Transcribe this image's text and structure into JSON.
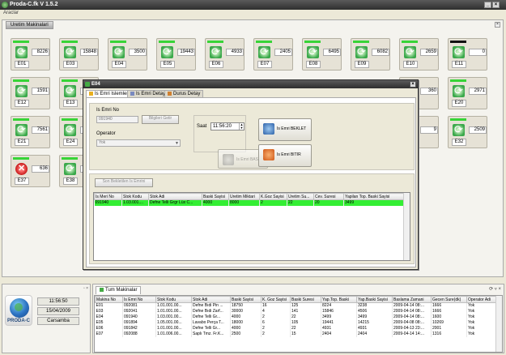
{
  "window": {
    "title": "Proda-C.fk V 1.5.2"
  },
  "menu": {
    "label": "Araclar"
  },
  "upper_tab": {
    "label": "Uretim Makinalari"
  },
  "machines": [
    {
      "label": "E01",
      "value": "8226",
      "status": "running"
    },
    {
      "label": "E03",
      "value": "15848",
      "status": "running"
    },
    {
      "label": "E04",
      "value": "3500",
      "status": "running"
    },
    {
      "label": "E05",
      "value": "19443",
      "status": "running"
    },
    {
      "label": "E06",
      "value": "4933",
      "status": "running"
    },
    {
      "label": "E07",
      "value": "2405",
      "status": "running"
    },
    {
      "label": "E08",
      "value": "6495",
      "status": "running"
    },
    {
      "label": "E09",
      "value": "6082",
      "status": "running"
    },
    {
      "label": "E10",
      "value": "2659",
      "status": "running"
    },
    {
      "label": "E11",
      "value": "0",
      "status": "idle"
    },
    {
      "label": "E12",
      "value": "1591",
      "status": "running"
    },
    {
      "label": "E13",
      "value": "",
      "status": "running"
    },
    {
      "label": "",
      "value": "360",
      "status": "running"
    },
    {
      "label": "E20",
      "value": "2971",
      "status": "running"
    },
    {
      "label": "E21",
      "value": "7561",
      "status": "running"
    },
    {
      "label": "E24",
      "value": "",
      "status": "running"
    },
    {
      "label": "",
      "value": "9",
      "status": "running"
    },
    {
      "label": "E32",
      "value": "2509",
      "status": "running"
    },
    {
      "label": "E37",
      "value": "636",
      "status": "stopped"
    },
    {
      "label": "E38",
      "value": "",
      "status": "running"
    }
  ],
  "dialog": {
    "title": "E04",
    "tabs": [
      "Is Emri Islemleri",
      "Is Emri Detay",
      "Durus Detay"
    ],
    "is_emri_label": "Is Emri No",
    "is_emri_value": "091940",
    "bilgileri_getir": "Bilgileri Getir",
    "operator_label": "Operator",
    "operator_value": "Yok",
    "saat_label": "Saat",
    "saat_value": "11:56:20",
    "is_emri_baslat": "Is Emri BASLAT",
    "is_emri_beklet": "Is Emri BEKLET",
    "is_emri_bitir": "Is Emri BITIR",
    "son_bekletilen": "Son Bekletilen Is Emrini",
    "grid_headers": [
      "Is Meri No",
      "Stok Kodu",
      "Stok Adi",
      "Baski Sayisi",
      "Uretim Miktari",
      "K.Goz Sayisi",
      "Uretim Su...",
      "Cev. Suresi",
      "Yapilan Top. Baski Sayisi"
    ],
    "grid_rows": [
      [
        "091940",
        "1.03.001....",
        "Defne Telli Grgr Lüx C...",
        "4000",
        "8000",
        "2",
        "22",
        "20",
        "3499"
      ]
    ]
  },
  "clock": {
    "time": "11:56:50",
    "date": "15/04/2009",
    "day": "Carsamba",
    "brand": "PRODA-C"
  },
  "bottom_tab": {
    "label": "Tum Makinalar"
  },
  "list": {
    "headers": [
      "Makina No",
      "Is Emri No",
      "Stok Kodu",
      "Stok Adi",
      "Baski Sayisi",
      "K. Goz Sayisi",
      "Baski Suresi",
      "Yap.Top. Baski",
      "Yap.Baski Sayisi",
      "Baslama Zamani",
      "Gecen Sure(dk)",
      "Operator Adi"
    ],
    "rows": [
      [
        "E01",
        "092081",
        "1.01.001.00...",
        "Defne Bıdi Pin ...",
        "18750",
        "16",
        "125",
        "8224",
        "3238",
        "2009-04-14 08:...",
        "1666",
        "Yok"
      ],
      [
        "E03",
        "092041",
        "1.01.001.00...",
        "Defne Bıdi Zarf...",
        "30000",
        "4",
        "141",
        "15846",
        "4506",
        "2009-04-14 08:...",
        "1666",
        "Yok"
      ],
      [
        "E04",
        "091940",
        "1.03.001.00...",
        "Defne Telli Gr...",
        "4000",
        "2",
        "22",
        "3499",
        "3499",
        "2009-04-14 08:...",
        "1600",
        "Yok"
      ],
      [
        "E05",
        "091894",
        "1.05.001.00...",
        "Lavabo Perça T...",
        "18000",
        "6",
        "105",
        "19441",
        "14215",
        "2009-04-08 08:...",
        "10269",
        "Yok"
      ],
      [
        "E06",
        "091842",
        "1.01.001.00...",
        "Defne Telli Gr...",
        "4000",
        "2",
        "22",
        "4931",
        "4931",
        "2009-04-13 23:...",
        "2001",
        "Yok"
      ],
      [
        "E07",
        "092088",
        "1.01.006.00...",
        "Saplı Tmz. Fr.K...",
        "2500",
        "2",
        "15",
        "2404",
        "2404",
        "2009-04-14 14:...",
        "1316",
        "Yok"
      ]
    ]
  }
}
